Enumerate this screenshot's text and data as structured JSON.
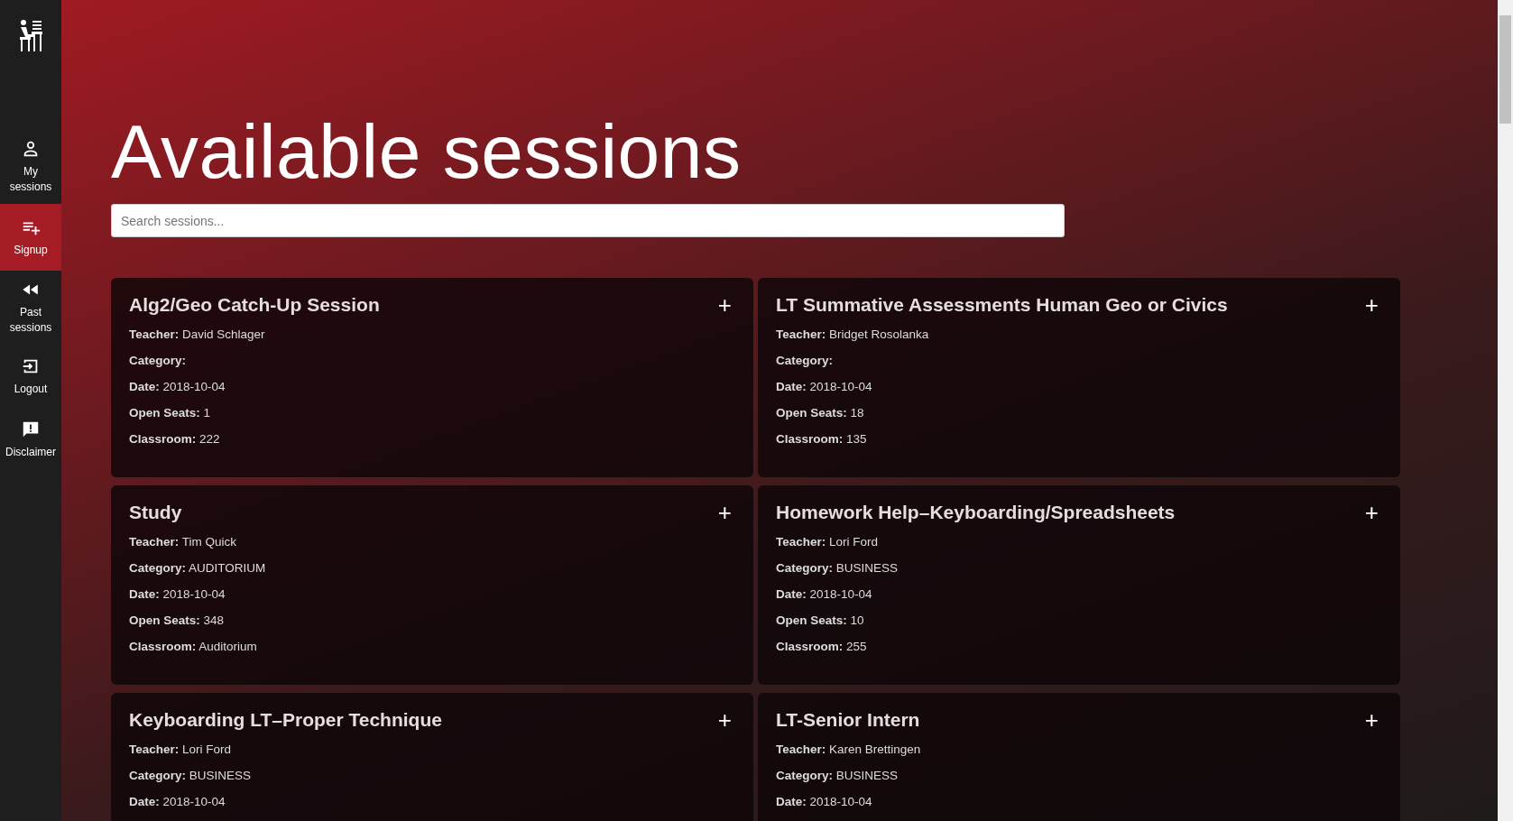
{
  "sidebar": {
    "items": [
      {
        "label": "My sessions",
        "selected": false
      },
      {
        "label": "Signup",
        "selected": true
      },
      {
        "label": "Past sessions",
        "selected": false
      },
      {
        "label": "Logout",
        "selected": false
      },
      {
        "label": "Disclaimer",
        "selected": false
      }
    ]
  },
  "page": {
    "title": "Available sessions",
    "search": {
      "placeholder": "Search sessions..."
    }
  },
  "sessions": [
    {
      "title": "Alg2/Geo Catch-Up Session",
      "add": "+",
      "fields": [
        {
          "label": "Teacher:",
          "value": "David Schlager"
        },
        {
          "label": "Category:"
        },
        {
          "label": "Date:",
          "value": "2018-10-04"
        },
        {
          "label": "Open Seats:",
          "value": "1"
        },
        {
          "label": "Classroom:",
          "value": "222"
        }
      ]
    },
    {
      "title": "LT Summative Assessments Human Geo or Civics",
      "add": "+",
      "fields": [
        {
          "label": "Teacher:",
          "value": "Bridget Rosolanka"
        },
        {
          "label": "Category:"
        },
        {
          "label": "Date:",
          "value": "2018-10-04"
        },
        {
          "label": "Open Seats:",
          "value": "18"
        },
        {
          "label": "Classroom:",
          "value": "135"
        }
      ]
    },
    {
      "title": "Study",
      "add": "+",
      "fields": [
        {
          "label": "Teacher:",
          "value": "Tim Quick"
        },
        {
          "label": "Category:",
          "value": "AUDITORIUM"
        },
        {
          "label": "Date:",
          "value": "2018-10-04"
        },
        {
          "label": "Open Seats:",
          "value": "348"
        },
        {
          "label": "Classroom:",
          "value": "Auditorium"
        }
      ]
    },
    {
      "title": "Homework Help–Keyboarding/Spreadsheets",
      "add": "+",
      "fields": [
        {
          "label": "Teacher:",
          "value": "Lori Ford"
        },
        {
          "label": "Category:",
          "value": "BUSINESS"
        },
        {
          "label": "Date:",
          "value": "2018-10-04"
        },
        {
          "label": "Open Seats:",
          "value": "10"
        },
        {
          "label": "Classroom:",
          "value": "255"
        }
      ]
    },
    {
      "title": "Keyboarding LT–Proper Technique",
      "add": "+",
      "fields": [
        {
          "label": "Teacher:",
          "value": "Lori Ford"
        },
        {
          "label": "Category:",
          "value": "BUSINESS"
        },
        {
          "label": "Date:",
          "value": "2018-10-04"
        }
      ]
    },
    {
      "title": "LT-Senior Intern",
      "add": "+",
      "fields": [
        {
          "label": "Teacher:",
          "value": "Karen Brettingen"
        },
        {
          "label": "Category:",
          "value": "BUSINESS"
        },
        {
          "label": "Date:",
          "value": "2018-10-04"
        }
      ]
    }
  ]
}
